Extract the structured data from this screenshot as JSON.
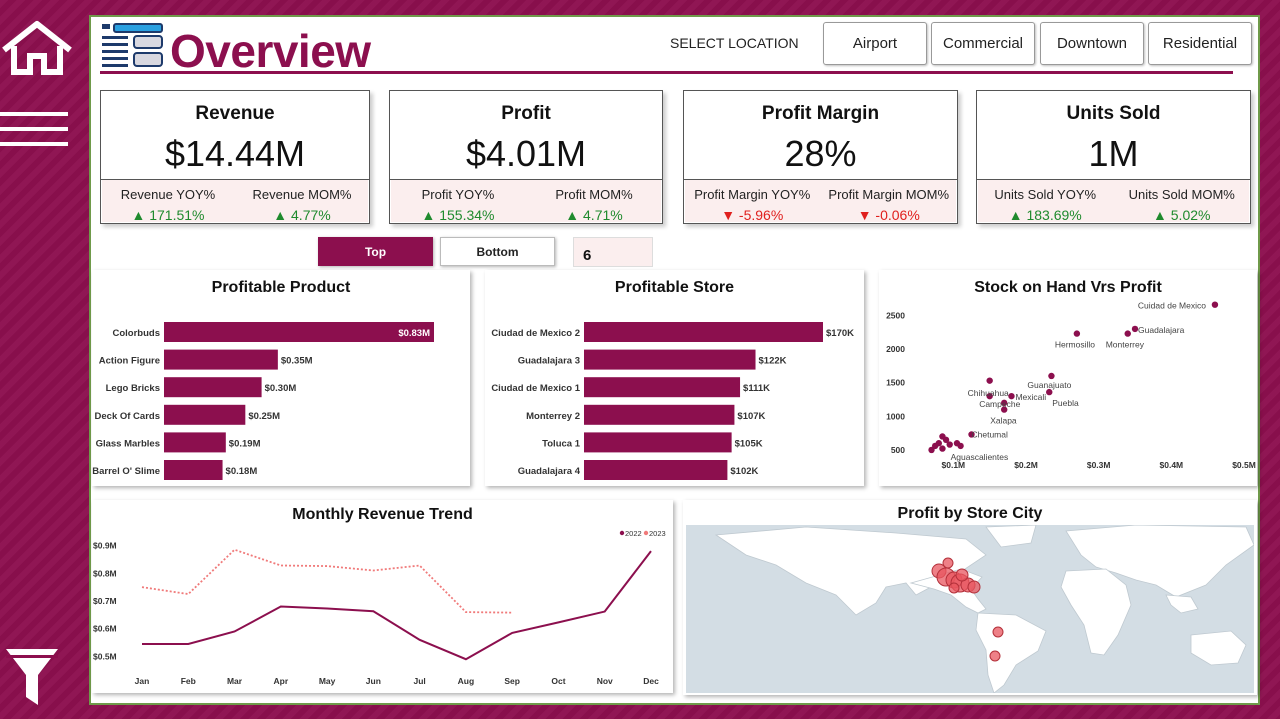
{
  "header": {
    "title": "Overview",
    "select_label": "SELECT LOCATION",
    "locations": [
      "Airport",
      "Commercial",
      "Downtown",
      "Residential"
    ]
  },
  "kpis": [
    {
      "title": "Revenue",
      "value": "$14.44M",
      "yoy_label": "Revenue YOY%",
      "yoy": "▲ 171.51%",
      "yoy_dir": "up",
      "mom_label": "Revenue MOM%",
      "mom": "▲ 4.77%",
      "mom_dir": "up"
    },
    {
      "title": "Profit",
      "value": "$4.01M",
      "yoy_label": "Profit YOY%",
      "yoy": "▲ 155.34%",
      "yoy_dir": "up",
      "mom_label": "Profit MOM%",
      "mom": "▲ 4.71%",
      "mom_dir": "up"
    },
    {
      "title": "Profit Margin",
      "value": "28%",
      "yoy_label": "Profit Margin YOY%",
      "yoy": "▼ -5.96%",
      "yoy_dir": "down",
      "mom_label": "Profit Margin MOM%",
      "mom": "▼ -0.06%",
      "mom_dir": "down"
    },
    {
      "title": "Units Sold",
      "value": "1M",
      "yoy_label": "Units Sold YOY%",
      "yoy": "▲ 183.69%",
      "yoy_dir": "up",
      "mom_label": "Units Sold MOM%",
      "mom": "▲ 5.02%",
      "mom_dir": "up"
    }
  ],
  "toggle": {
    "top": "Top",
    "bottom": "Bottom",
    "n": "6"
  },
  "colors": {
    "brand": "#8c0f4e",
    "series2023": "#f07a7a",
    "up": "#1f8a2d",
    "down": "#e0201e"
  },
  "map": {
    "title": "Profit by Store City"
  },
  "chart_data": [
    {
      "type": "bar",
      "title": "Profitable Product",
      "categories": [
        "Colorbuds",
        "Action Figure",
        "Lego Bricks",
        "Deck Of Cards",
        "Glass Marbles",
        "Barrel O' Slime"
      ],
      "values": [
        0.83,
        0.35,
        0.3,
        0.25,
        0.19,
        0.18
      ],
      "labels": [
        "$0.83M",
        "$0.35M",
        "$0.30M",
        "$0.25M",
        "$0.19M",
        "$0.18M"
      ],
      "orientation": "horizontal"
    },
    {
      "type": "bar",
      "title": "Profitable Store",
      "categories": [
        "Ciudad de Mexico 2",
        "Guadalajara 3",
        "Ciudad de Mexico 1",
        "Monterrey 2",
        "Toluca 1",
        "Guadalajara 4"
      ],
      "values": [
        170,
        122,
        111,
        107,
        105,
        102
      ],
      "labels": [
        "$170K",
        "$122K",
        "$111K",
        "$107K",
        "$105K",
        "$102K"
      ],
      "orientation": "horizontal"
    },
    {
      "type": "scatter",
      "title": "Stock on Hand Vrs Profit",
      "xticks": [
        "$0.1M",
        "$0.2M",
        "$0.3M",
        "$0.4M",
        "$0.5M"
      ],
      "xtick_values": [
        0.1,
        0.2,
        0.3,
        0.4,
        0.5
      ],
      "yticks": [
        "500",
        "1000",
        "1500",
        "2000",
        "2500"
      ],
      "ytick_values": [
        500,
        1000,
        1500,
        2000,
        2500
      ],
      "xlim": [
        0.05,
        0.5
      ],
      "ylim": [
        380,
        2700
      ],
      "points": [
        {
          "x": 0.46,
          "y": 2660,
          "label": "Cuidad de Mexico"
        },
        {
          "x": 0.35,
          "y": 2300,
          "label": "Guadalajara"
        },
        {
          "x": 0.34,
          "y": 2230,
          "label": "Monterrey"
        },
        {
          "x": 0.27,
          "y": 2230,
          "label": "Hermosillo"
        },
        {
          "x": 0.235,
          "y": 1600,
          "label": "Guanajuato"
        },
        {
          "x": 0.232,
          "y": 1360,
          "label": "Puebla"
        },
        {
          "x": 0.15,
          "y": 1530,
          "label": ""
        },
        {
          "x": 0.15,
          "y": 1300,
          "label": "Chihuahua"
        },
        {
          "x": 0.18,
          "y": 1300,
          "label": "Mexicali"
        },
        {
          "x": 0.17,
          "y": 1200,
          "label": "Campeche"
        },
        {
          "x": 0.17,
          "y": 1100,
          "label": "Xalapa"
        },
        {
          "x": 0.125,
          "y": 730,
          "label": "Chetumal"
        },
        {
          "x": 0.085,
          "y": 700,
          "label": ""
        },
        {
          "x": 0.09,
          "y": 650,
          "label": ""
        },
        {
          "x": 0.08,
          "y": 600,
          "label": ""
        },
        {
          "x": 0.075,
          "y": 560,
          "label": ""
        },
        {
          "x": 0.095,
          "y": 580,
          "label": ""
        },
        {
          "x": 0.105,
          "y": 600,
          "label": ""
        },
        {
          "x": 0.07,
          "y": 500,
          "label": ""
        },
        {
          "x": 0.085,
          "y": 520,
          "label": ""
        },
        {
          "x": 0.11,
          "y": 560,
          "label": "Aguascalientes"
        }
      ]
    },
    {
      "type": "line",
      "title": "Monthly Revenue Trend",
      "categories": [
        "Jan",
        "Feb",
        "Mar",
        "Apr",
        "May",
        "Jun",
        "Jul",
        "Aug",
        "Sep",
        "Oct",
        "Nov",
        "Dec"
      ],
      "yticks": [
        "$0.5M",
        "$0.6M",
        "$0.7M",
        "$0.8M",
        "$0.9M"
      ],
      "ytick_values": [
        0.5,
        0.6,
        0.7,
        0.8,
        0.9
      ],
      "ylim": [
        0.48,
        0.92
      ],
      "series": [
        {
          "name": "2022",
          "values": [
            0.545,
            0.545,
            0.59,
            0.68,
            0.673,
            0.663,
            0.56,
            0.49,
            0.585,
            0.623,
            0.662,
            0.88
          ]
        },
        {
          "name": "2023",
          "values": [
            0.75,
            0.725,
            0.885,
            0.828,
            0.826,
            0.81,
            0.828,
            0.66,
            0.658
          ]
        }
      ]
    }
  ]
}
